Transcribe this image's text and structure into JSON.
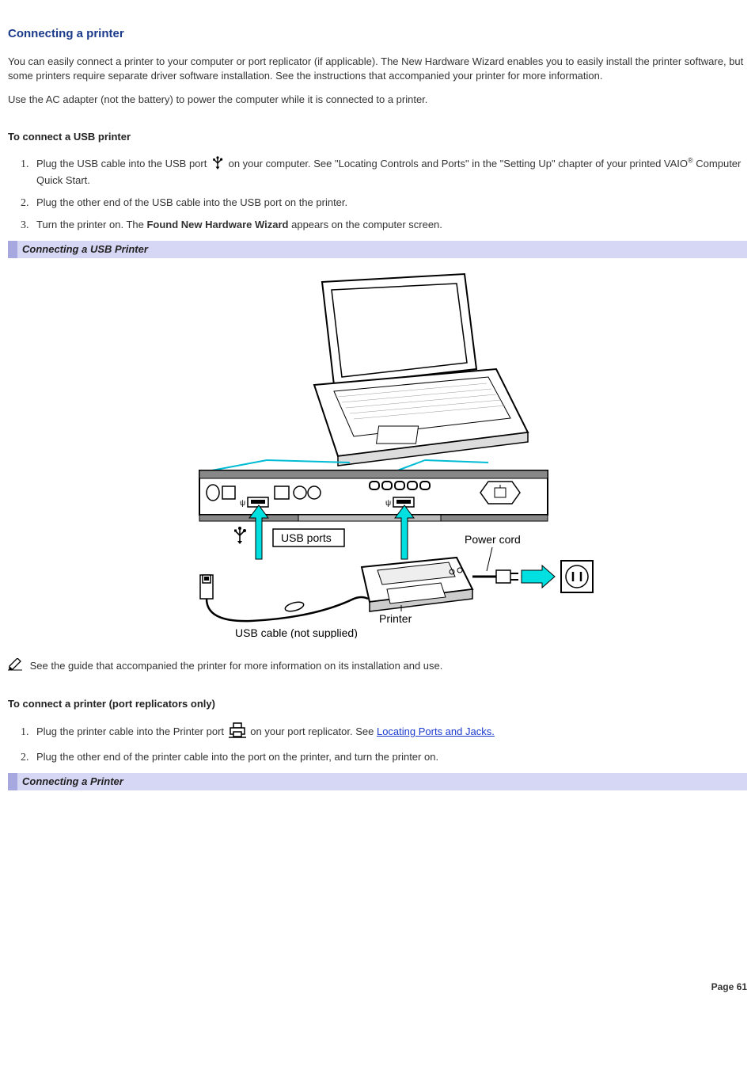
{
  "title": "Connecting a printer",
  "intro_p1": "You can easily connect a printer to your computer or port replicator (if applicable). The New Hardware Wizard enables you to easily install the printer software, but some printers require separate driver software installation. See the instructions that accompanied your printer for more information.",
  "intro_p2": "Use the AC adapter (not the battery) to power the computer while it is connected to a printer.",
  "section_usb_title": "To connect a USB printer",
  "usb_step1_a": "Plug the USB cable into the USB port ",
  "usb_step1_b": " on your computer. See \"Locating Controls and Ports\" in the \"Setting Up\" chapter of your printed VAIO",
  "usb_step1_c": " Computer Quick Start.",
  "reg_mark": "®",
  "usb_step2": "Plug the other end of the USB cable into the USB port on the printer.",
  "usb_step3_a": "Turn the printer on. The ",
  "usb_step3_bold": "Found New Hardware Wizard",
  "usb_step3_b": " appears on the computer screen.",
  "caption_usb": "Connecting a USB Printer",
  "figure_labels": {
    "usb_ports": "USB ports",
    "power_cord": "Power cord",
    "printer": "Printer",
    "usb_cable": "USB cable (not supplied)"
  },
  "note_text": "See the guide that accompanied the printer for more information on its installation and use.",
  "section_port_title": "To connect a printer (port replicators only)",
  "port_step1_a": "Plug the printer cable into the Printer port ",
  "port_step1_b": " on your port replicator. See ",
  "port_link": "Locating Ports and Jacks.",
  "port_step2": "Plug the other end of the printer cable into the port on the printer, and turn the printer on.",
  "caption_printer": "Connecting a Printer",
  "page_number": "Page 61"
}
